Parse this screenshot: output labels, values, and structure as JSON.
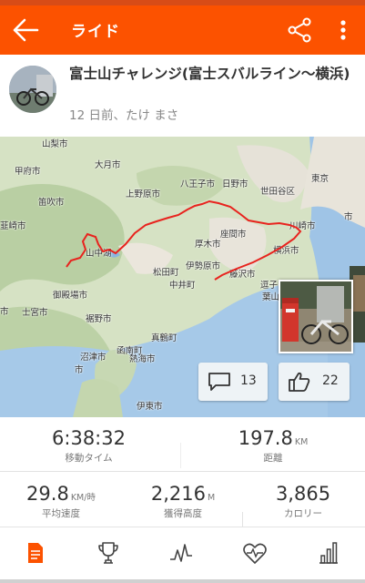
{
  "app": {
    "title": "ライド",
    "accent": "#fc5200"
  },
  "activity": {
    "title": "富士山チャレンジ(富士スバルライン〜横浜)",
    "subtitle": "12 日前、たけ まさ"
  },
  "map": {
    "labels": [
      "山梨市",
      "甲府市",
      "大月市",
      "八王子市",
      "日野市",
      "東京",
      "世田谷区",
      "笛吹市",
      "上野原市",
      "川崎市",
      "韮崎市",
      "座間市",
      "横浜市",
      "厚木市",
      "伊勢原市",
      "松田町",
      "藤沢市",
      "中井町",
      "御殿場市",
      "裾野市",
      "士宮市",
      "真鶴町",
      "函南町",
      "熱海市",
      "沼津市",
      "伊東市",
      "山中湖",
      "市",
      "逗子",
      "葉山",
      "市",
      "市"
    ],
    "route_color": "#e8231e"
  },
  "social": {
    "comments": "13",
    "kudos": "22"
  },
  "stats": {
    "moving_time": {
      "value": "6:38:32",
      "label": "移動タイム"
    },
    "distance": {
      "value": "197.8",
      "unit": "KM",
      "label": "距離"
    },
    "avg_speed": {
      "value": "29.8",
      "unit": "KM/時",
      "label": "平均速度"
    },
    "elevation": {
      "value": "2,216",
      "unit": "M",
      "label": "獲得高度"
    },
    "calories": {
      "value": "3,865",
      "label": "カロリー"
    }
  },
  "tabs": [
    {
      "icon": "overview-icon"
    },
    {
      "icon": "trophy-icon"
    },
    {
      "icon": "analysis-icon"
    },
    {
      "icon": "heart-icon"
    },
    {
      "icon": "segments-icon"
    }
  ]
}
